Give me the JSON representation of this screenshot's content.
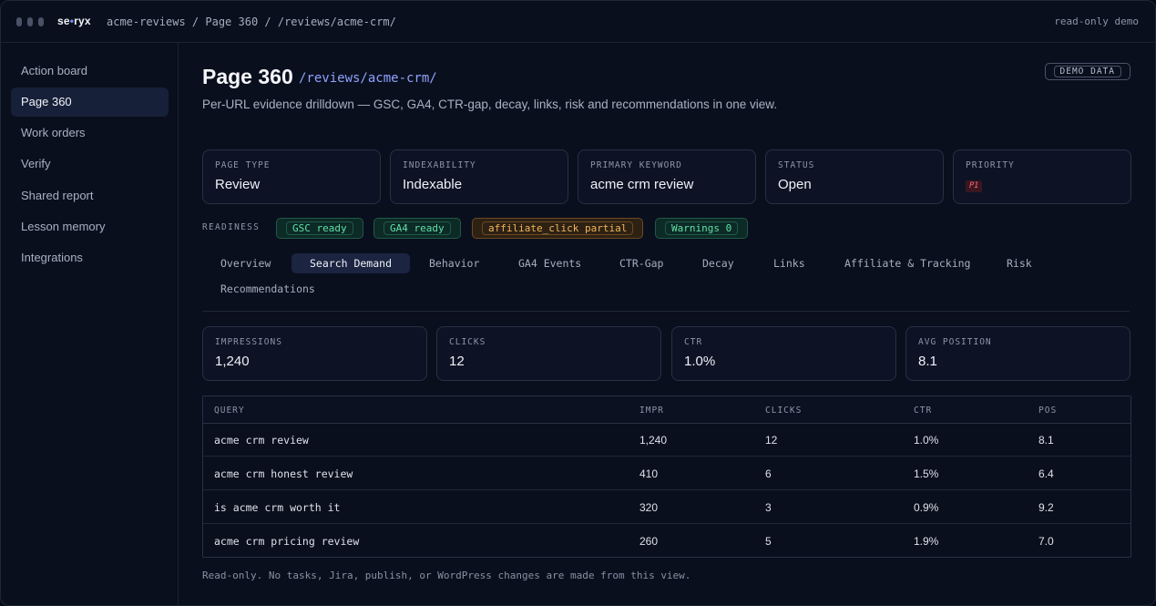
{
  "topbar": {
    "logo_main": "se",
    "logo_dot": "•",
    "logo_tail": "ryx",
    "breadcrumb": "acme-reviews / Page 360 / /reviews/acme-crm/",
    "mode": "read-only demo"
  },
  "sidebar": {
    "items": [
      {
        "label": "Action board"
      },
      {
        "label": "Page 360"
      },
      {
        "label": "Work orders"
      },
      {
        "label": "Verify"
      },
      {
        "label": "Shared report"
      },
      {
        "label": "Lesson memory"
      },
      {
        "label": "Integrations"
      }
    ],
    "active": "Page 360"
  },
  "page": {
    "title": "Page 360",
    "path": "/reviews/acme-crm/",
    "description": "Per-URL evidence drilldown — GSC, GA4, CTR-gap, decay, links, risk and recommendations in one view.",
    "badge": "DEMO DATA"
  },
  "cards": [
    {
      "label": "PAGE TYPE",
      "value": "Review"
    },
    {
      "label": "INDEXABILITY",
      "value": "Indexable"
    },
    {
      "label": "PRIMARY KEYWORD",
      "value": "acme crm review"
    },
    {
      "label": "STATUS",
      "value": "Open"
    },
    {
      "label": "PRIORITY",
      "value": "P1"
    }
  ],
  "readiness": {
    "label": "READINESS",
    "chips": [
      {
        "label": "GSC ready",
        "tone": "ok"
      },
      {
        "label": "GA4 ready",
        "tone": "ok"
      },
      {
        "label": "affiliate_click partial",
        "tone": "warn"
      },
      {
        "label": "Warnings 0",
        "tone": "ok"
      }
    ]
  },
  "tabs": [
    {
      "label": "Overview"
    },
    {
      "label": "Search Demand"
    },
    {
      "label": "Behavior"
    },
    {
      "label": "GA4 Events"
    },
    {
      "label": "CTR-Gap"
    },
    {
      "label": "Decay"
    },
    {
      "label": "Links"
    },
    {
      "label": "Affiliate & Tracking"
    },
    {
      "label": "Risk"
    },
    {
      "label": "Recommendations"
    }
  ],
  "active_tab": "Search Demand",
  "metrics": [
    {
      "label": "IMPRESSIONS",
      "value": "1,240"
    },
    {
      "label": "CLICKS",
      "value": "12"
    },
    {
      "label": "CTR",
      "value": "1.0%"
    },
    {
      "label": "AVG POSITION",
      "value": "8.1"
    }
  ],
  "table": {
    "columns": [
      "QUERY",
      "IMPR",
      "CLICKS",
      "CTR",
      "POS"
    ],
    "rows": [
      [
        "acme crm review",
        "1,240",
        "12",
        "1.0%",
        "8.1"
      ],
      [
        "acme crm honest review",
        "410",
        "6",
        "1.5%",
        "6.4"
      ],
      [
        "is acme crm worth it",
        "320",
        "3",
        "0.9%",
        "9.2"
      ],
      [
        "acme crm pricing review",
        "260",
        "5",
        "1.9%",
        "7.0"
      ]
    ]
  },
  "footer_note": "Read-only. No tasks, Jira, publish, or WordPress changes are made from this view."
}
